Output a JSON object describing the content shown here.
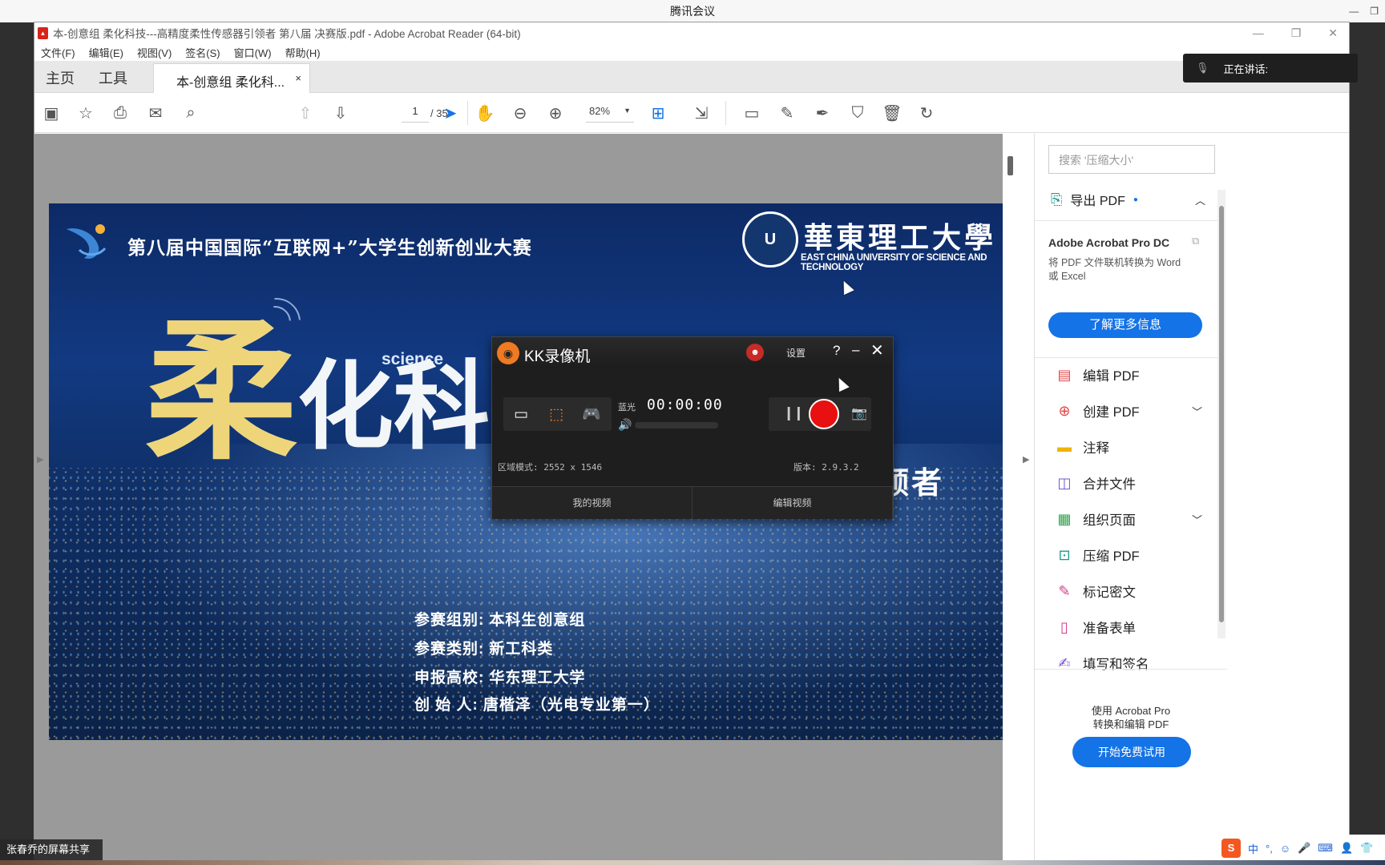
{
  "meeting": {
    "title": "腾讯会议",
    "speaking_label": "正在讲话:",
    "share_label": "张春乔的屏幕共享"
  },
  "acrobat": {
    "window_title": "本-创意组 柔化科技---高精度柔性传感器引领者 第八届 决赛版.pdf - Adobe Acrobat Reader (64-bit)",
    "menu": [
      "文件(F)",
      "编辑(E)",
      "视图(V)",
      "签名(S)",
      "窗口(W)",
      "帮助(H)"
    ],
    "tabs": {
      "home": "主页",
      "tools": "工具",
      "doc": "本-创意组 柔化科...",
      "close": "×"
    },
    "page_current": "1",
    "page_total": "/ 35",
    "zoom": "82%"
  },
  "slide": {
    "contest_title": "第八届中国国际“互联网+”大学生创新创业大赛",
    "university_cn": "華東理工大學",
    "university_en": "EAST CHINA UNIVERSITY OF SCIENCE AND TECHNOLOGY",
    "seal_text": "U",
    "big_char1": "柔",
    "big_char2": "化科",
    "science_word": "science",
    "subtitle_fragment": "器引领者",
    "info": [
      {
        "label": "参赛组别:",
        "value": "本科生创意组"
      },
      {
        "label": "参赛类别:",
        "value": "新工科类"
      },
      {
        "label": "申报高校:",
        "value": "华东理工大学"
      },
      {
        "label": "创 始 人:",
        "value": "唐楷泽（光电专业第一）"
      }
    ]
  },
  "right_panel": {
    "search_placeholder": "搜索 '压缩大小'",
    "export_label": "导出 PDF",
    "pro_title": "Adobe Acrobat Pro DC",
    "pro_desc": "将 PDF 文件联机转换为 Word 或 Excel",
    "learn_more": "了解更多信息",
    "tools": [
      {
        "label": "编辑 PDF",
        "color": "#e3464a",
        "glyph": "▤"
      },
      {
        "label": "创建 PDF",
        "color": "#e3464a",
        "glyph": "⊕"
      },
      {
        "label": "注释",
        "color": "#f0b400",
        "glyph": "▬"
      },
      {
        "label": "合并文件",
        "color": "#6a5acd",
        "glyph": "◫"
      },
      {
        "label": "组织页面",
        "color": "#2ca24a",
        "glyph": "▦"
      },
      {
        "label": "压缩 PDF",
        "color": "#1a9a8a",
        "glyph": "⊡"
      },
      {
        "label": "标记密文",
        "color": "#d6378c",
        "glyph": "✎"
      },
      {
        "label": "准备表单",
        "color": "#d6378c",
        "glyph": "▯"
      },
      {
        "label": "填写和签名",
        "color": "#7b4fd1",
        "glyph": "✍"
      }
    ],
    "use_pro": "使用 Acrobat Pro\n转换和编辑 PDF",
    "trial": "开始免费试用"
  },
  "kk": {
    "title": "KK录像机",
    "settings": "设置",
    "help": "?",
    "minimize": "–",
    "close": "✕",
    "quality": "蓝光",
    "time": "00:00:00",
    "mode_text": "区域模式: 2552 x 1546",
    "version": "版本: 2.9.3.2",
    "my_videos": "我的视频",
    "edit_video": "编辑视频"
  },
  "ime": {
    "lang": "中"
  }
}
